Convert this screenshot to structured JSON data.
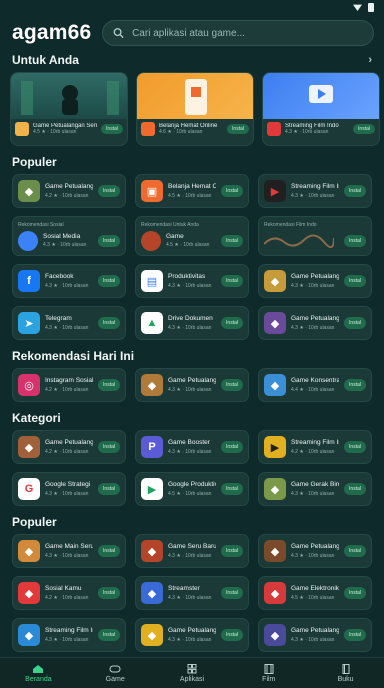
{
  "app": {
    "title": "agam66"
  },
  "search": {
    "placeholder": "Cari aplikasi atau game..."
  },
  "sections": {
    "featured": "Untuk Anda",
    "popular1": "Populer",
    "recommend": "Rekomendasi Hari Ini",
    "category": "Kategori",
    "popular2": "Populer"
  },
  "featured": [
    {
      "name": "Game Petualangan Seru",
      "meta": "4.5 ★ · 10rb ulasan",
      "button": "Instal",
      "color": "#f0b24a"
    },
    {
      "name": "Belanja Hemat Online",
      "meta": "4.6 ★ · 10rb ulasan",
      "button": "Instal",
      "color": "#ef6a2e"
    },
    {
      "name": "Streaming Film Indo",
      "meta": "4.3 ★ · 10rb ulasan",
      "button": "Instal",
      "color": "#e23a3a"
    }
  ],
  "popular1": [
    {
      "name": "Game Petualangan",
      "meta": "4.2 ★ · 10rb ulasan",
      "button": "Instal",
      "color": "#6b8f4a",
      "glyph": "◆"
    },
    {
      "name": "Belanja Hemat Online",
      "meta": "4.5 ★ · 10rb ulasan",
      "button": "Instal",
      "color": "#ef6a2e",
      "glyph": "▣"
    },
    {
      "name": "Streaming Film Indo",
      "meta": "4.3 ★ · 10rb ulasan",
      "button": "Instal",
      "color": "#202020",
      "glyph": "▶"
    }
  ],
  "promos": [
    {
      "label": "Rekomendasi Sosial",
      "name": "Sosial Media",
      "meta": "4.3 ★ · 10rb ulasan",
      "button": "Instal",
      "color": "#3b82f6"
    },
    {
      "label": "Rekomendasi Untuk Anda",
      "name": "Game",
      "meta": "4.5 ★ · 10rb ulasan",
      "button": "Instal",
      "color": "#b5452a"
    },
    {
      "label": "Rekomendasi Film Indo",
      "name": "",
      "meta": "",
      "button": "Instal",
      "color": "#8a6a4a"
    }
  ],
  "popular1b": [
    {
      "name": "Facebook",
      "meta": "4.3 ★ · 10rb ulasan",
      "button": "Instal",
      "color": "#1877f2",
      "glyph": "f"
    },
    {
      "name": "Produktivitas",
      "meta": "4.3 ★ · 10rb ulasan",
      "button": "Instal",
      "color": "#ffffff",
      "glyph": "▤"
    },
    {
      "name": "Game Petualangan",
      "meta": "4.3 ★ · 10rb ulasan",
      "button": "Instal",
      "color": "#c79a3a",
      "glyph": "◆"
    },
    {
      "name": "Telegram",
      "meta": "4.3 ★ · 10rb ulasan",
      "button": "Instal",
      "color": "#2aa3e0",
      "glyph": "➤"
    },
    {
      "name": "Drive Dokumen",
      "meta": "4.3 ★ · 10rb ulasan",
      "button": "Instal",
      "color": "#ffffff",
      "glyph": "▲"
    },
    {
      "name": "Game Petualangan",
      "meta": "4.3 ★ · 10rb ulasan",
      "button": "Instal",
      "color": "#6a4a9a",
      "glyph": "◆"
    }
  ],
  "recommend": [
    {
      "name": "Instagram Sosial",
      "meta": "4.2 ★ · 10rb ulasan",
      "button": "Instal",
      "color": "#d6336c",
      "glyph": "◎"
    },
    {
      "name": "Game Petualangan",
      "meta": "4.3 ★ · 10rb ulasan",
      "button": "Instal",
      "color": "#b07a3a",
      "glyph": "◆"
    },
    {
      "name": "Game Konsentrasi",
      "meta": "4.4 ★ · 10rb ulasan",
      "button": "Instal",
      "color": "#3a8fd6",
      "glyph": "◆"
    }
  ],
  "category": [
    {
      "name": "Game Petualangan",
      "meta": "4.2 ★ · 10rb ulasan",
      "button": "Instal",
      "color": "#a0603a",
      "glyph": "◆"
    },
    {
      "name": "Game Booster",
      "meta": "4.3 ★ · 10rb ulasan",
      "button": "Instal",
      "color": "#5b5bd6",
      "glyph": "P"
    },
    {
      "name": "Streaming Film Indo",
      "meta": "4.2 ★ · 10rb ulasan",
      "button": "Instal",
      "color": "#e0b020",
      "glyph": "▶"
    },
    {
      "name": "Google Strategi",
      "meta": "4.3 ★ · 10rb ulasan",
      "button": "Instal",
      "color": "#ffffff",
      "glyph": "G"
    },
    {
      "name": "Google Produktivitas",
      "meta": "4.5 ★ · 10rb ulasan",
      "button": "Instal",
      "color": "#ffffff",
      "glyph": "▶"
    },
    {
      "name": "Game Gerak Bin",
      "meta": "4.3 ★ · 10rb ulasan",
      "button": "Instal",
      "color": "#7a9a4a",
      "glyph": "◆"
    }
  ],
  "popular2": [
    {
      "name": "Game Main Seru",
      "meta": "4.3 ★ · 10rb ulasan",
      "button": "Instal",
      "color": "#d08a3a",
      "glyph": "◆"
    },
    {
      "name": "Game Seru Baru",
      "meta": "4.3 ★ · 10rb ulasan",
      "button": "Instal",
      "color": "#b5452a",
      "glyph": "◆"
    },
    {
      "name": "Game Petualangan",
      "meta": "4.3 ★ · 10rb ulasan",
      "button": "Instal",
      "color": "#7a4a2a",
      "glyph": "◆"
    },
    {
      "name": "Sosial Kamu",
      "meta": "4.2 ★ · 10rb ulasan",
      "button": "Instal",
      "color": "#e23a3a",
      "glyph": "◆"
    },
    {
      "name": "Streamster",
      "meta": "4.3 ★ · 10rb ulasan",
      "button": "Instal",
      "color": "#3a6ad6",
      "glyph": "◆"
    },
    {
      "name": "Game Elektronik",
      "meta": "4.5 ★ · 10rb ulasan",
      "button": "Instal",
      "color": "#d63a3a",
      "glyph": "◆"
    },
    {
      "name": "Streaming Film Indo",
      "meta": "4.3 ★ · 10rb ulasan",
      "button": "Instal",
      "color": "#2a8ad6",
      "glyph": "◆"
    },
    {
      "name": "Game Petualangan",
      "meta": "4.3 ★ · 10rb ulasan",
      "button": "Instal",
      "color": "#e0b020",
      "glyph": "◆"
    },
    {
      "name": "Game Petualangan",
      "meta": "4.3 ★ · 10rb ulasan",
      "button": "Instal",
      "color": "#4a4a9a",
      "glyph": "◆"
    }
  ],
  "nav": [
    {
      "label": "Beranda",
      "icon": "home-icon"
    },
    {
      "label": "Game",
      "icon": "gamepad-icon"
    },
    {
      "label": "Aplikasi",
      "icon": "apps-icon"
    },
    {
      "label": "Film",
      "icon": "film-icon"
    },
    {
      "label": "Buku",
      "icon": "book-icon"
    }
  ],
  "colors": {
    "background": "#0f2a2a",
    "card": "#1a3937",
    "accent": "#3cd28c",
    "button": "#1f6b4b"
  }
}
